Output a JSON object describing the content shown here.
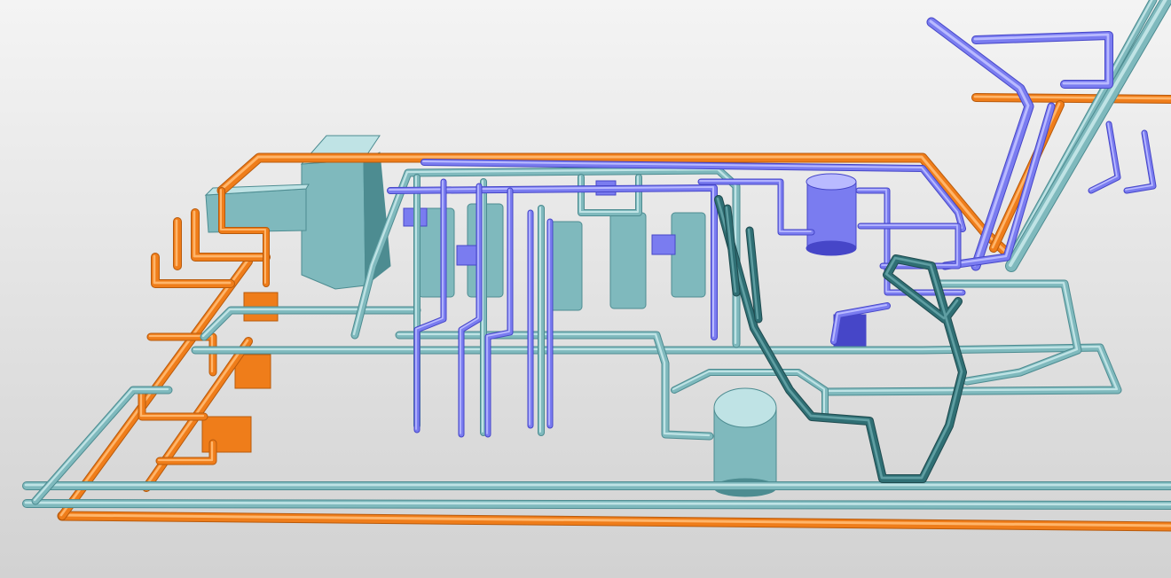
{
  "viewport": {
    "background_top": "#f4f4f4",
    "background_bottom": "#d2d2d2"
  },
  "systems": [
    {
      "id": "teal",
      "color": "#7fb9bd",
      "dark": "#4d8c91",
      "light": "#bfe3e5"
    },
    {
      "id": "blue-violet",
      "color": "#7a7cf0",
      "dark": "#4646c8",
      "light": "#b9baff"
    },
    {
      "id": "orange",
      "color": "#ef7d1a",
      "dark": "#b85a0c",
      "light": "#ffb56a"
    },
    {
      "id": "dark-teal",
      "color": "#2f6f74",
      "dark": "#1f4b4f",
      "light": "#5f9ea2"
    }
  ]
}
